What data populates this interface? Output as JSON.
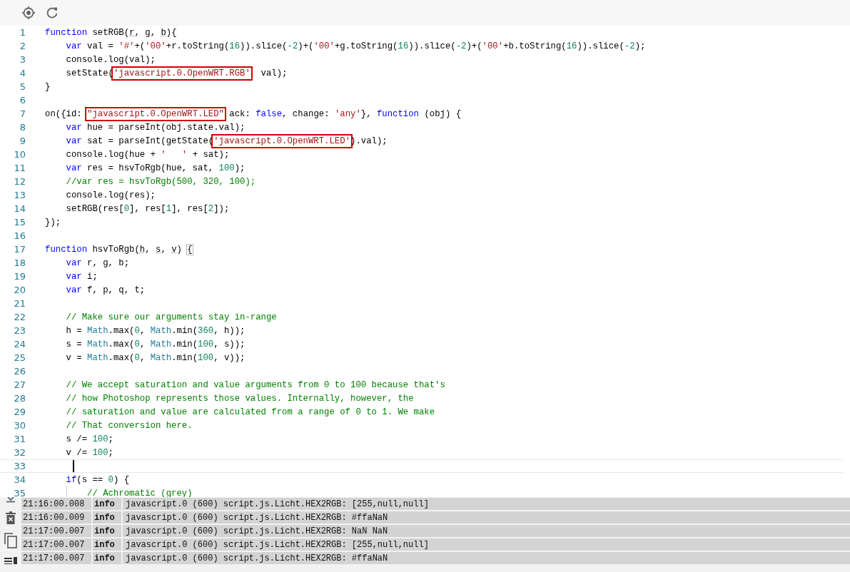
{
  "toolbar": {
    "buttons": [
      {
        "kind": "locate"
      },
      {
        "kind": "reload"
      }
    ]
  },
  "editor": {
    "lines": [
      {
        "number": "1",
        "active": false,
        "tokens": [
          {
            "kind": "keyword",
            "text": "function"
          },
          {
            "kind": "plain",
            "text": " setRGB("
          },
          {
            "kind": "param",
            "text": "r"
          },
          {
            "kind": "plain",
            "text": ", "
          },
          {
            "kind": "param",
            "text": "g"
          },
          {
            "kind": "plain",
            "text": ", "
          },
          {
            "kind": "param",
            "text": "b"
          },
          {
            "kind": "plain",
            "text": "){"
          }
        ]
      },
      {
        "number": "2",
        "active": false,
        "tokens": [
          {
            "kind": "indent"
          },
          {
            "kind": "keyword",
            "text": "var"
          },
          {
            "kind": "plain",
            "text": " val = "
          },
          {
            "kind": "string",
            "text": "'#'"
          },
          {
            "kind": "plain",
            "text": "+("
          },
          {
            "kind": "string",
            "text": "'00'"
          },
          {
            "kind": "plain",
            "text": "+r.toString("
          },
          {
            "kind": "number",
            "text": "16"
          },
          {
            "kind": "plain",
            "text": ")).slice("
          },
          {
            "kind": "number",
            "text": "-2"
          },
          {
            "kind": "plain",
            "text": ")+("
          },
          {
            "kind": "string",
            "text": "'00'"
          },
          {
            "kind": "plain",
            "text": "+g.toString("
          },
          {
            "kind": "number",
            "text": "16"
          },
          {
            "kind": "plain",
            "text": ")).slice("
          },
          {
            "kind": "number",
            "text": "-2"
          },
          {
            "kind": "plain",
            "text": ")+("
          },
          {
            "kind": "string",
            "text": "'00'"
          },
          {
            "kind": "plain",
            "text": "+b.toString("
          },
          {
            "kind": "number",
            "text": "16"
          },
          {
            "kind": "plain",
            "text": ")).slice("
          },
          {
            "kind": "number",
            "text": "-2"
          },
          {
            "kind": "plain",
            "text": ");"
          }
        ]
      },
      {
        "number": "3",
        "active": false,
        "tokens": [
          {
            "kind": "indent"
          },
          {
            "kind": "plain",
            "text": "console.log(val);"
          }
        ]
      },
      {
        "number": "4",
        "active": false,
        "tokens": [
          {
            "kind": "indent"
          },
          {
            "kind": "plain",
            "text": "setState("
          },
          {
            "kind": "boxed-string",
            "text": "'javascript.0.OpenWRT.RGB'"
          },
          {
            "kind": "plain",
            "text": "  val);"
          }
        ]
      },
      {
        "number": "5",
        "active": false,
        "tokens": [
          {
            "kind": "plain",
            "text": "}"
          }
        ]
      },
      {
        "number": "6",
        "active": false
      },
      {
        "number": "7",
        "active": false,
        "tokens": [
          {
            "kind": "plain",
            "text": "on({id: "
          },
          {
            "kind": "boxed-string",
            "text": "\"javascript.0.OpenWRT.LED\""
          },
          {
            "kind": "plain",
            "text": " ack: "
          },
          {
            "kind": "keyword",
            "text": "false"
          },
          {
            "kind": "plain",
            "text": ", change: "
          },
          {
            "kind": "string",
            "text": "'any'"
          },
          {
            "kind": "plain",
            "text": "}, "
          },
          {
            "kind": "keyword",
            "text": "function"
          },
          {
            "kind": "plain",
            "text": " (obj) {"
          }
        ]
      },
      {
        "number": "8",
        "active": false,
        "tokens": [
          {
            "kind": "indent"
          },
          {
            "kind": "keyword",
            "text": "var"
          },
          {
            "kind": "plain",
            "text": " hue = parseInt(obj.state.val);"
          }
        ]
      },
      {
        "number": "9",
        "active": false,
        "tokens": [
          {
            "kind": "indent"
          },
          {
            "kind": "keyword",
            "text": "var"
          },
          {
            "kind": "plain",
            "text": " sat = parseInt(getState("
          },
          {
            "kind": "boxed-string",
            "text": "'javascript.0.OpenWRT.LED'"
          },
          {
            "kind": "plain",
            "text": ").val);"
          }
        ]
      },
      {
        "number": "10",
        "active": false,
        "tokens": [
          {
            "kind": "indent"
          },
          {
            "kind": "plain",
            "text": "console.log(hue + "
          },
          {
            "kind": "string",
            "text": "'   '"
          },
          {
            "kind": "plain",
            "text": " + sat);"
          }
        ]
      },
      {
        "number": "11",
        "active": false,
        "tokens": [
          {
            "kind": "indent"
          },
          {
            "kind": "keyword",
            "text": "var"
          },
          {
            "kind": "plain",
            "text": " res = hsvToRgb(hue, sat, "
          },
          {
            "kind": "number",
            "text": "100"
          },
          {
            "kind": "plain",
            "text": ");"
          }
        ]
      },
      {
        "number": "12",
        "active": false,
        "tokens": [
          {
            "kind": "indent"
          },
          {
            "kind": "comment",
            "text": "//var res = hsvToRgb(500, 320, 100);"
          }
        ]
      },
      {
        "number": "13",
        "active": false,
        "tokens": [
          {
            "kind": "indent"
          },
          {
            "kind": "plain",
            "text": "console.log(res);"
          }
        ]
      },
      {
        "number": "14",
        "active": false,
        "tokens": [
          {
            "kind": "indent"
          },
          {
            "kind": "plain",
            "text": "setRGB(res["
          },
          {
            "kind": "number",
            "text": "0"
          },
          {
            "kind": "plain",
            "text": "], res["
          },
          {
            "kind": "number",
            "text": "1"
          },
          {
            "kind": "plain",
            "text": "], res["
          },
          {
            "kind": "number",
            "text": "2"
          },
          {
            "kind": "plain",
            "text": "]);"
          }
        ]
      },
      {
        "number": "15",
        "active": false,
        "tokens": [
          {
            "kind": "plain",
            "text": "});"
          }
        ]
      },
      {
        "number": "16",
        "active": false
      },
      {
        "number": "17",
        "active": false,
        "tokens": [
          {
            "kind": "keyword",
            "text": "function"
          },
          {
            "kind": "plain",
            "text": " hsvToRgb("
          },
          {
            "kind": "param",
            "text": "h"
          },
          {
            "kind": "plain",
            "text": ", "
          },
          {
            "kind": "param",
            "text": "s"
          },
          {
            "kind": "plain",
            "text": ", "
          },
          {
            "kind": "param",
            "text": "v"
          },
          {
            "kind": "plain",
            "text": ") "
          },
          {
            "kind": "bracket",
            "text": "{"
          }
        ]
      },
      {
        "number": "18",
        "active": false,
        "tokens": [
          {
            "kind": "indent"
          },
          {
            "kind": "keyword",
            "text": "var"
          },
          {
            "kind": "plain",
            "text": " r, g, b;"
          }
        ]
      },
      {
        "number": "19",
        "active": false,
        "tokens": [
          {
            "kind": "indent"
          },
          {
            "kind": "keyword",
            "text": "var"
          },
          {
            "kind": "plain",
            "text": " i;"
          }
        ]
      },
      {
        "number": "20",
        "active": false,
        "tokens": [
          {
            "kind": "indent"
          },
          {
            "kind": "keyword",
            "text": "var"
          },
          {
            "kind": "plain",
            "text": " f, p, q, t;"
          }
        ]
      },
      {
        "number": "21",
        "active": false,
        "tokens": [
          {
            "kind": "indent"
          }
        ]
      },
      {
        "number": "22",
        "active": false,
        "tokens": [
          {
            "kind": "indent"
          },
          {
            "kind": "comment",
            "text": "// Make sure our arguments stay in-range"
          }
        ]
      },
      {
        "number": "23",
        "active": false,
        "tokens": [
          {
            "kind": "indent"
          },
          {
            "kind": "plain",
            "text": "h = "
          },
          {
            "kind": "builtin",
            "text": "Math"
          },
          {
            "kind": "plain",
            "text": ".max("
          },
          {
            "kind": "number",
            "text": "0"
          },
          {
            "kind": "plain",
            "text": ", "
          },
          {
            "kind": "builtin",
            "text": "Math"
          },
          {
            "kind": "plain",
            "text": ".min("
          },
          {
            "kind": "number",
            "text": "360"
          },
          {
            "kind": "plain",
            "text": ", h));"
          }
        ]
      },
      {
        "number": "24",
        "active": false,
        "tokens": [
          {
            "kind": "indent"
          },
          {
            "kind": "plain",
            "text": "s = "
          },
          {
            "kind": "builtin",
            "text": "Math"
          },
          {
            "kind": "plain",
            "text": ".max("
          },
          {
            "kind": "number",
            "text": "0"
          },
          {
            "kind": "plain",
            "text": ", "
          },
          {
            "kind": "builtin",
            "text": "Math"
          },
          {
            "kind": "plain",
            "text": ".min("
          },
          {
            "kind": "number",
            "text": "100"
          },
          {
            "kind": "plain",
            "text": ", s));"
          }
        ]
      },
      {
        "number": "25",
        "active": false,
        "tokens": [
          {
            "kind": "indent"
          },
          {
            "kind": "plain",
            "text": "v = "
          },
          {
            "kind": "builtin",
            "text": "Math"
          },
          {
            "kind": "plain",
            "text": ".max("
          },
          {
            "kind": "number",
            "text": "0"
          },
          {
            "kind": "plain",
            "text": ", "
          },
          {
            "kind": "builtin",
            "text": "Math"
          },
          {
            "kind": "plain",
            "text": ".min("
          },
          {
            "kind": "number",
            "text": "100"
          },
          {
            "kind": "plain",
            "text": ", v));"
          }
        ]
      },
      {
        "number": "26",
        "active": false,
        "tokens": [
          {
            "kind": "indent"
          }
        ]
      },
      {
        "number": "27",
        "active": false,
        "tokens": [
          {
            "kind": "indent"
          },
          {
            "kind": "comment",
            "text": "// We accept saturation and value arguments from 0 to 100 because that's"
          }
        ]
      },
      {
        "number": "28",
        "active": false,
        "tokens": [
          {
            "kind": "indent"
          },
          {
            "kind": "comment",
            "text": "// how Photoshop represents those values. Internally, however, the"
          }
        ]
      },
      {
        "number": "29",
        "active": false,
        "tokens": [
          {
            "kind": "indent"
          },
          {
            "kind": "comment",
            "text": "// saturation and value are calculated from a range of 0 to 1. We make"
          }
        ]
      },
      {
        "number": "30",
        "active": false,
        "tokens": [
          {
            "kind": "indent"
          },
          {
            "kind": "comment",
            "text": "// That conversion here."
          }
        ]
      },
      {
        "number": "31",
        "active": false,
        "tokens": [
          {
            "kind": "indent"
          },
          {
            "kind": "plain",
            "text": "s /= "
          },
          {
            "kind": "number",
            "text": "100"
          },
          {
            "kind": "plain",
            "text": ";"
          }
        ]
      },
      {
        "number": "32",
        "active": false,
        "tokens": [
          {
            "kind": "indent"
          },
          {
            "kind": "plain",
            "text": "v /= "
          },
          {
            "kind": "number",
            "text": "100"
          },
          {
            "kind": "plain",
            "text": ";"
          }
        ]
      },
      {
        "number": "33",
        "active": true,
        "tokens": [
          {
            "kind": "indent"
          }
        ]
      },
      {
        "number": "34",
        "active": false,
        "tokens": [
          {
            "kind": "indent"
          },
          {
            "kind": "keyword",
            "text": "if"
          },
          {
            "kind": "plain",
            "text": "(s == "
          },
          {
            "kind": "number",
            "text": "0"
          },
          {
            "kind": "plain",
            "text": ") {"
          }
        ]
      },
      {
        "number": "35",
        "active": false,
        "tokens": [
          {
            "kind": "indent"
          },
          {
            "kind": "indent"
          },
          {
            "kind": "comment",
            "text": "// Achromatic (grey)"
          }
        ]
      }
    ]
  },
  "log": {
    "tools": [
      {
        "kind": "scroll-down"
      },
      {
        "kind": "clear"
      },
      {
        "kind": "copy"
      },
      {
        "kind": "list"
      }
    ],
    "rows": [
      {
        "time": "21:16:00.008",
        "severity": "info",
        "message": "javascript.0 (600) script.js.Licht.HEX2RGB: [255,null,null]"
      },
      {
        "time": "21:16:00.009",
        "severity": "info",
        "message": "javascript.0 (600) script.js.Licht.HEX2RGB: #ffaNaN"
      },
      {
        "time": "21:17:00.007",
        "severity": "info",
        "message": "javascript.0 (600) script.js.Licht.HEX2RGB: NaN NaN"
      },
      {
        "time": "21:17:00.007",
        "severity": "info",
        "message": "javascript.0 (600) script.js.Licht.HEX2RGB: [255,null,null]"
      },
      {
        "time": "21:17:00.007",
        "severity": "info",
        "message": "javascript.0 (600) script.js.Licht.HEX2RGB: #ffaNaN"
      }
    ]
  }
}
